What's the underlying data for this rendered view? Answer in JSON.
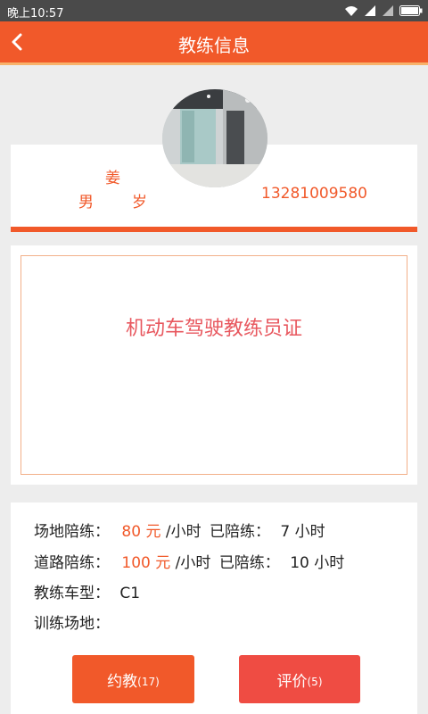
{
  "status_bar": {
    "time": "晚上10:57"
  },
  "header": {
    "title": "教练信息"
  },
  "coach": {
    "surname": "姜",
    "gender": "男",
    "age_unit": "岁",
    "phone": "13281009580"
  },
  "certificate": {
    "label": "机动车驾驶教练员证"
  },
  "info": {
    "site_label": "场地陪练：",
    "site_price": "80 元",
    "site_unit": "/小时",
    "site_trained_label": "已陪练：",
    "site_trained_value": "7 小时",
    "road_label": "道路陪练：",
    "road_price": "100 元",
    "road_unit": "/小时",
    "road_trained_label": "已陪练：",
    "road_trained_value": "10 小时",
    "car_type_label": "教练车型：",
    "car_type_value": "C1",
    "venue_label": "训练场地：",
    "venue_value": ""
  },
  "actions": {
    "book_label": "约教",
    "book_count": "(17)",
    "review_label": "评价",
    "review_count": "(5)"
  },
  "colors": {
    "accent": "#f1592a",
    "review": "#ef4c43",
    "cert_text": "#e8585f"
  },
  "icons": [
    "back-arrow-icon",
    "wifi-icon",
    "signal-icon",
    "battery-icon"
  ]
}
